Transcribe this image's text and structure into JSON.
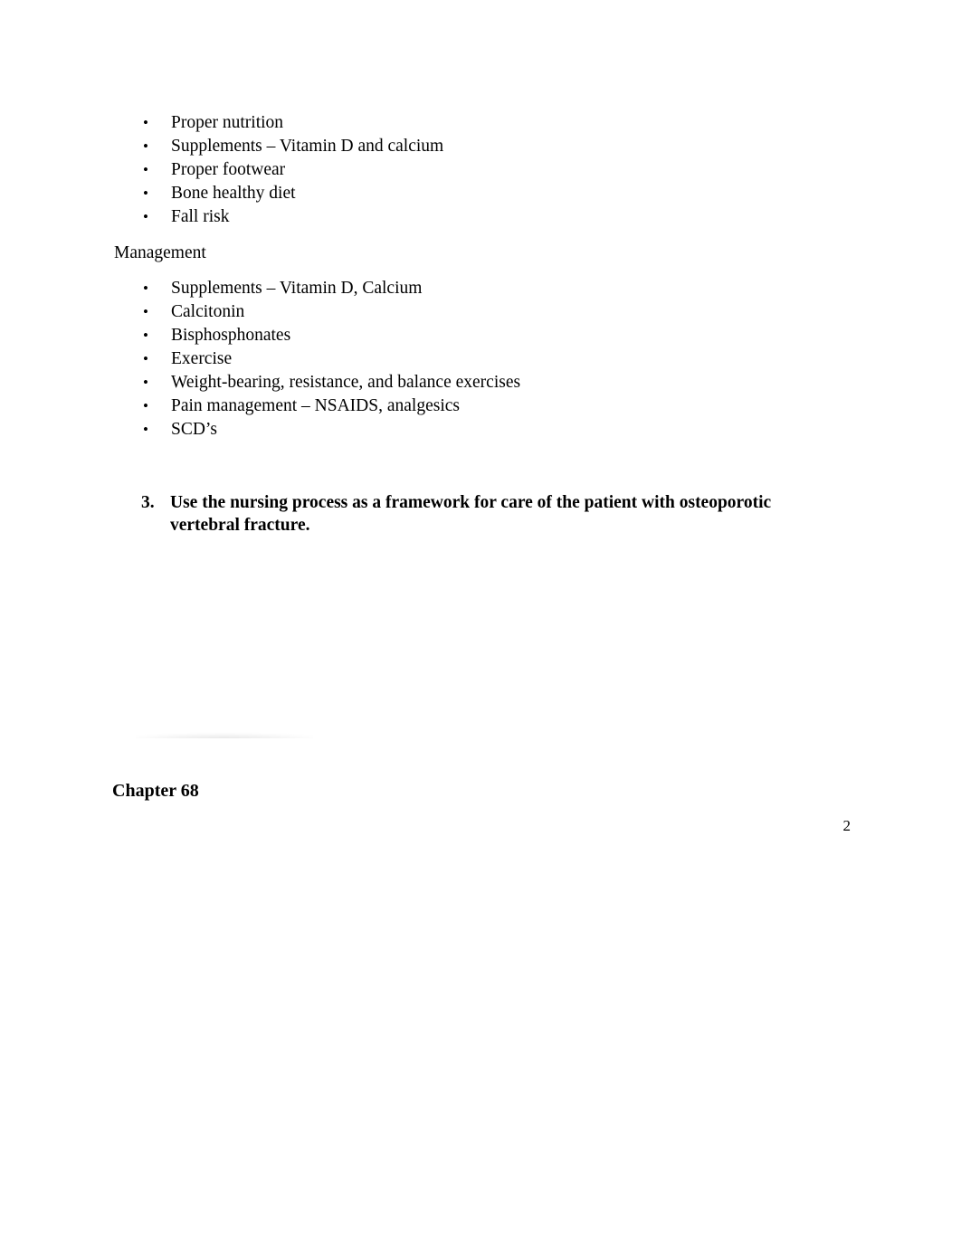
{
  "document": {
    "page_number": "2",
    "background_color": "#ffffff",
    "text_color": "#000000"
  },
  "prevention_list": {
    "bullet_glyph": "•",
    "items": [
      {
        "text": "Proper nutrition"
      },
      {
        "text": "Supplements – Vitamin D and calcium"
      },
      {
        "text": "Proper footwear"
      },
      {
        "text": "Bone healthy diet"
      },
      {
        "text": "Fall risk"
      }
    ]
  },
  "management_heading": {
    "text": "Management"
  },
  "management_list": {
    "bullet_glyph": "•",
    "items": [
      {
        "text": "Supplements – Vitamin D, Calcium"
      },
      {
        "text": "Calcitonin"
      },
      {
        "text": "Bisphosphonates"
      },
      {
        "text": "Exercise"
      },
      {
        "text": "Weight-bearing, resistance, and balance exercises"
      },
      {
        "text": "Pain management – NSAIDS, analgesics"
      },
      {
        "text": "SCD’s"
      }
    ]
  },
  "numbered_items": [
    {
      "marker": "3.",
      "text": "Use the nursing process as a framework for care of the patient with osteoporotic vertebral fracture."
    }
  ],
  "chapter_heading": {
    "text": "Chapter 68"
  }
}
